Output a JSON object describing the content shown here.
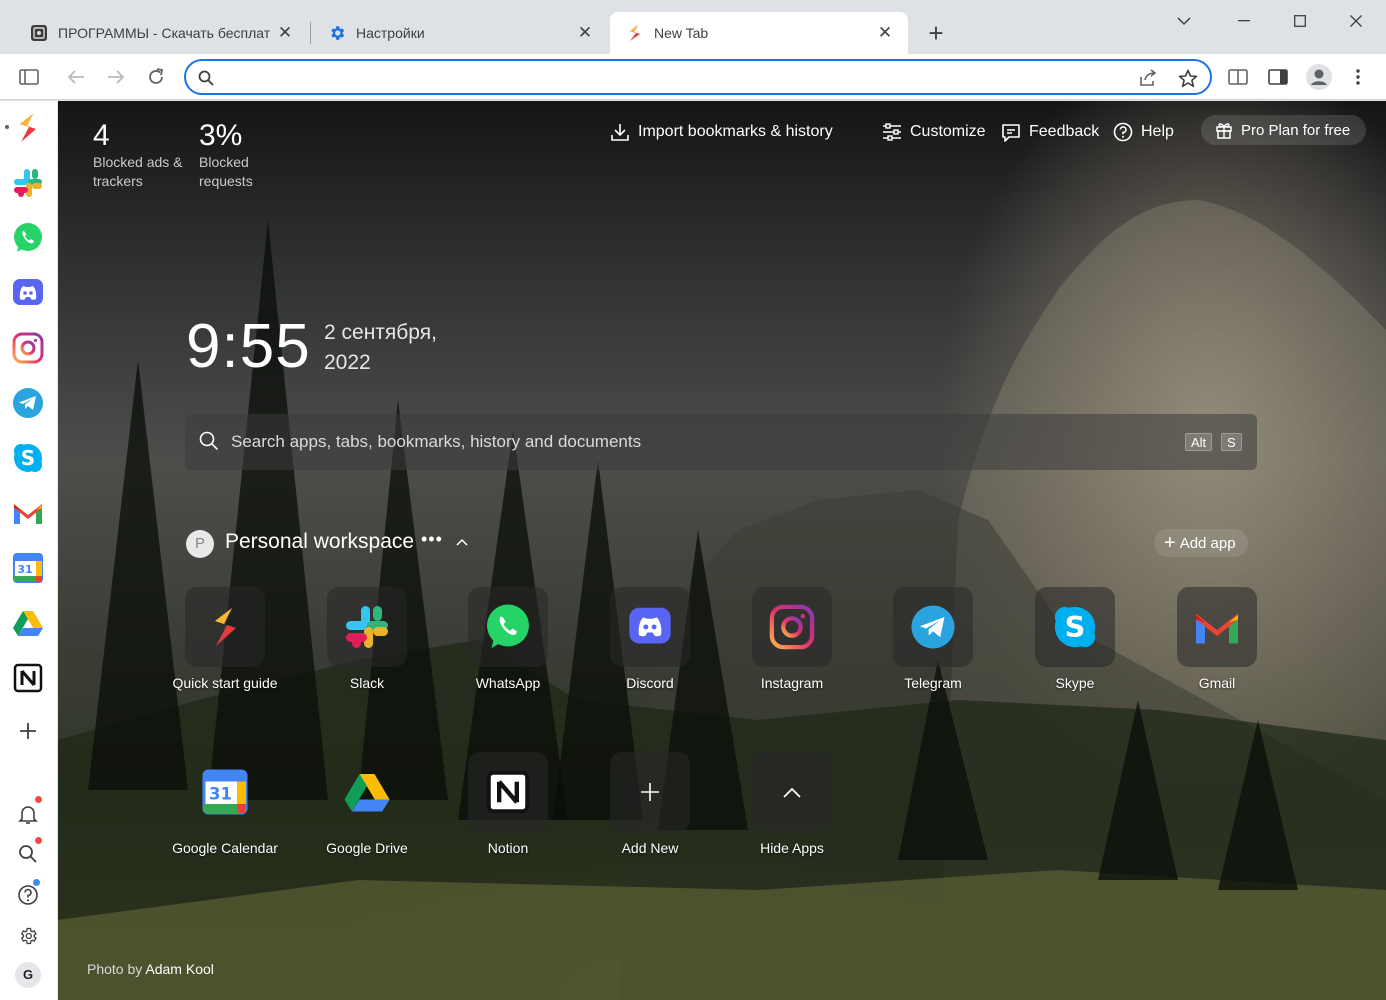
{
  "tabs": [
    {
      "title": "ПРОГРАММЫ - Скачать бесплат",
      "icon": "grid-app-icon",
      "active": false
    },
    {
      "title": "Настройки",
      "icon": "settings-gear-icon",
      "active": false
    },
    {
      "title": "New Tab",
      "icon": "shift-logo-icon",
      "active": true
    }
  ],
  "omnibox": {
    "value": "",
    "placeholder": ""
  },
  "stats": [
    {
      "value": "4",
      "label": "Blocked ads & trackers"
    },
    {
      "value": "3%",
      "label": "Blocked requests"
    }
  ],
  "topnav": {
    "import": "Import bookmarks & history",
    "customize": "Customize",
    "feedback": "Feedback",
    "help": "Help",
    "pro": "Pro Plan for free"
  },
  "clock": {
    "time": "9:55",
    "date": "2 сентября, 2022"
  },
  "search": {
    "placeholder": "Search apps, tabs, bookmarks, history and documents",
    "key1": "Alt",
    "key2": "S"
  },
  "workspace": {
    "avatar": "P",
    "title": "Personal workspace",
    "more": "•••",
    "add_app": "Add app"
  },
  "apps_row1": [
    {
      "name": "Quick start guide",
      "icon": "shift-logo-icon"
    },
    {
      "name": "Slack",
      "icon": "slack-icon"
    },
    {
      "name": "WhatsApp",
      "icon": "whatsapp-icon"
    },
    {
      "name": "Discord",
      "icon": "discord-icon"
    },
    {
      "name": "Instagram",
      "icon": "instagram-icon"
    },
    {
      "name": "Telegram",
      "icon": "telegram-icon"
    },
    {
      "name": "Skype",
      "icon": "skype-icon"
    },
    {
      "name": "Gmail",
      "icon": "gmail-icon"
    }
  ],
  "apps_row2": [
    {
      "name": "Google Calendar",
      "icon": "google-calendar-icon"
    },
    {
      "name": "Google Drive",
      "icon": "google-drive-icon"
    },
    {
      "name": "Notion",
      "icon": "notion-icon"
    },
    {
      "name": "Add New",
      "icon": "plus-icon"
    },
    {
      "name": "Hide Apps",
      "icon": "chevron-up-icon"
    }
  ],
  "calendar_day": "31",
  "sidebar_user_initial": "G",
  "photo_credit": {
    "prefix": "Photo by",
    "author": "Adam Kool"
  },
  "colors": {
    "accent": "#1a73e8",
    "notification_dot": "#f04a45"
  }
}
